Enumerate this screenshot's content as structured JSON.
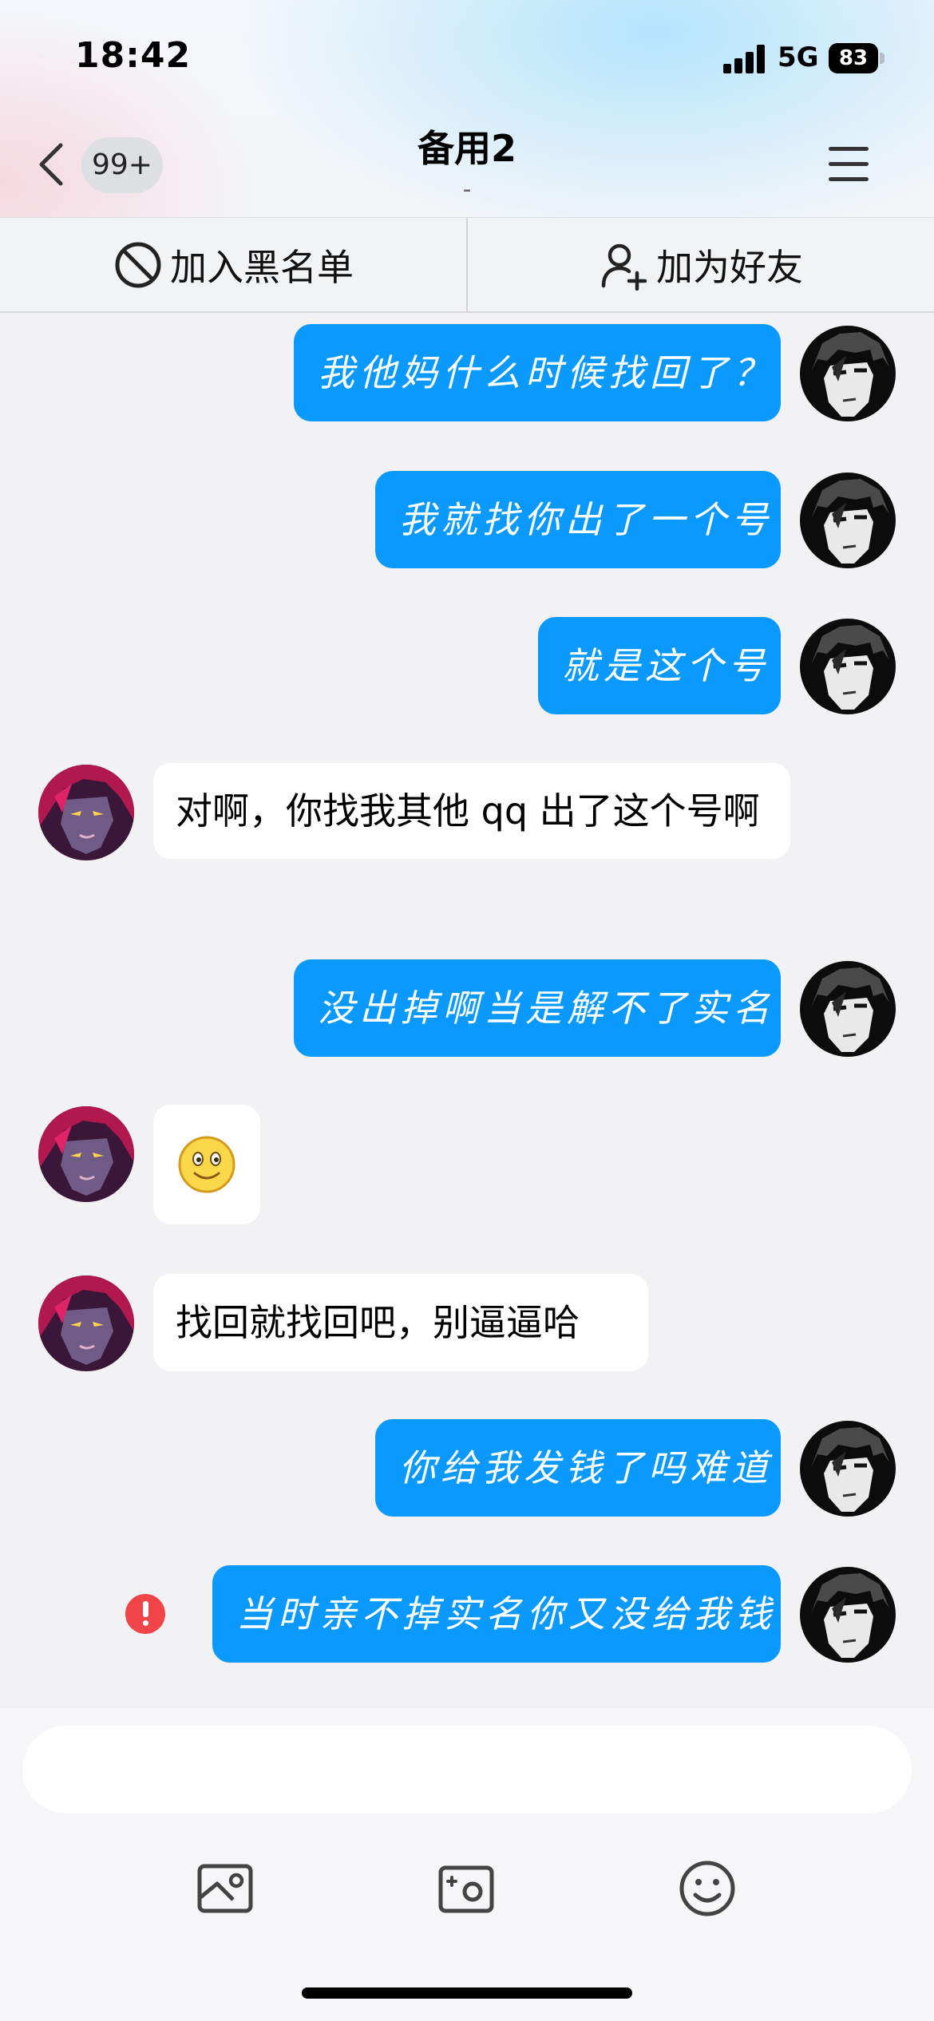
{
  "status_bar": {
    "time": "18:42",
    "network": "5G",
    "battery": "83"
  },
  "header": {
    "unread_count": "99+",
    "title": "备用2",
    "subtitle": "-"
  },
  "actions": {
    "blacklist_label": "加入黑名单",
    "add_friend_label": "加为好友"
  },
  "messages": [
    {
      "side": "out",
      "text": "我他妈什么时候找回了？"
    },
    {
      "side": "out",
      "text": "我就找你出了一个号"
    },
    {
      "side": "out",
      "text": "就是这个号"
    },
    {
      "side": "in",
      "text": "对啊，你找我其他 qq 出了这个号啊"
    },
    {
      "side": "out",
      "text": "没出掉啊当是解不了实名"
    },
    {
      "side": "in",
      "emoji": "smile"
    },
    {
      "side": "in",
      "text": "找回就找回吧，别逼逼哈"
    },
    {
      "side": "out",
      "text": "你给我发钱了吗难道"
    },
    {
      "side": "out",
      "text": "当时亲不掉实名你又没给我钱",
      "send_failed": true
    }
  ],
  "input": {
    "placeholder": ""
  },
  "toolbar": [
    "image-icon",
    "camera-icon",
    "emoji-icon"
  ]
}
